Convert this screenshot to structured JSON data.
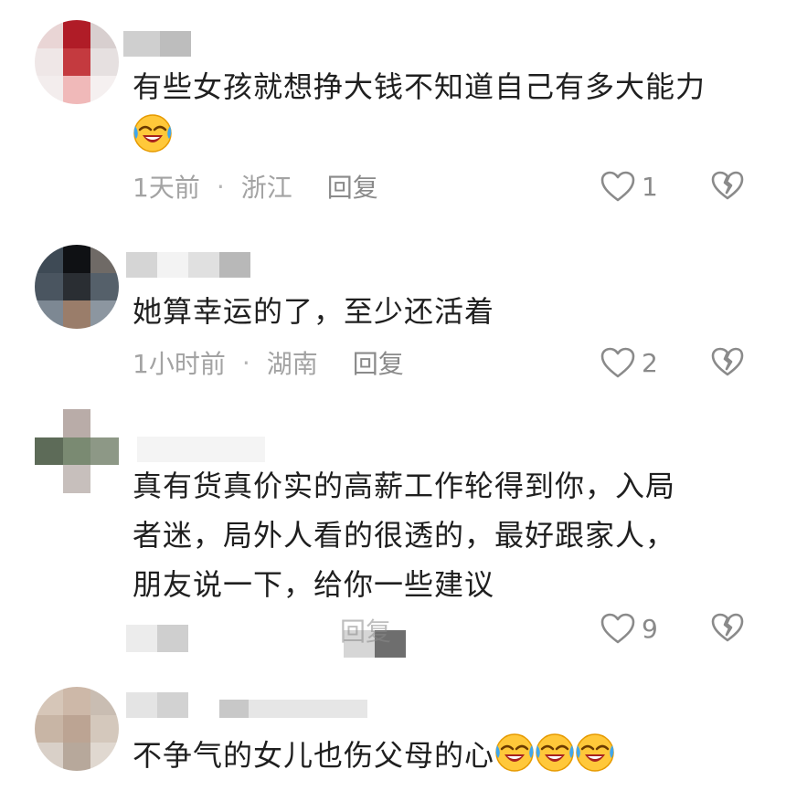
{
  "comments": [
    {
      "text": "有些女孩就想挣大钱不知道自己有多大能力",
      "emoji_count": 1,
      "time": "1天前",
      "location": "浙江",
      "reply_label": "回复",
      "likes": "1"
    },
    {
      "text": "她算幸运的了，至少还活着",
      "emoji_count": 0,
      "time": "1小时前",
      "location": "湖南",
      "reply_label": "回复",
      "likes": "2"
    },
    {
      "line1": "真有货真价实的高薪工作轮得到你，入局",
      "line2": "者迷，局外人看的很透的，最好跟家人，",
      "line3": "朋友说一下，给你一些建议",
      "reply_label": "回复",
      "likes": "9"
    },
    {
      "text": "不争气的女儿也伤父母的心",
      "emoji_count": 3
    }
  ],
  "colors": {
    "text": "#1f1f1f",
    "meta": "#a3a3a3",
    "icon": "#8a8a8a"
  },
  "icons": {
    "like": "heart-outline-icon",
    "dislike": "broken-heart-icon",
    "emoji": "laughing-crying-emoji"
  }
}
